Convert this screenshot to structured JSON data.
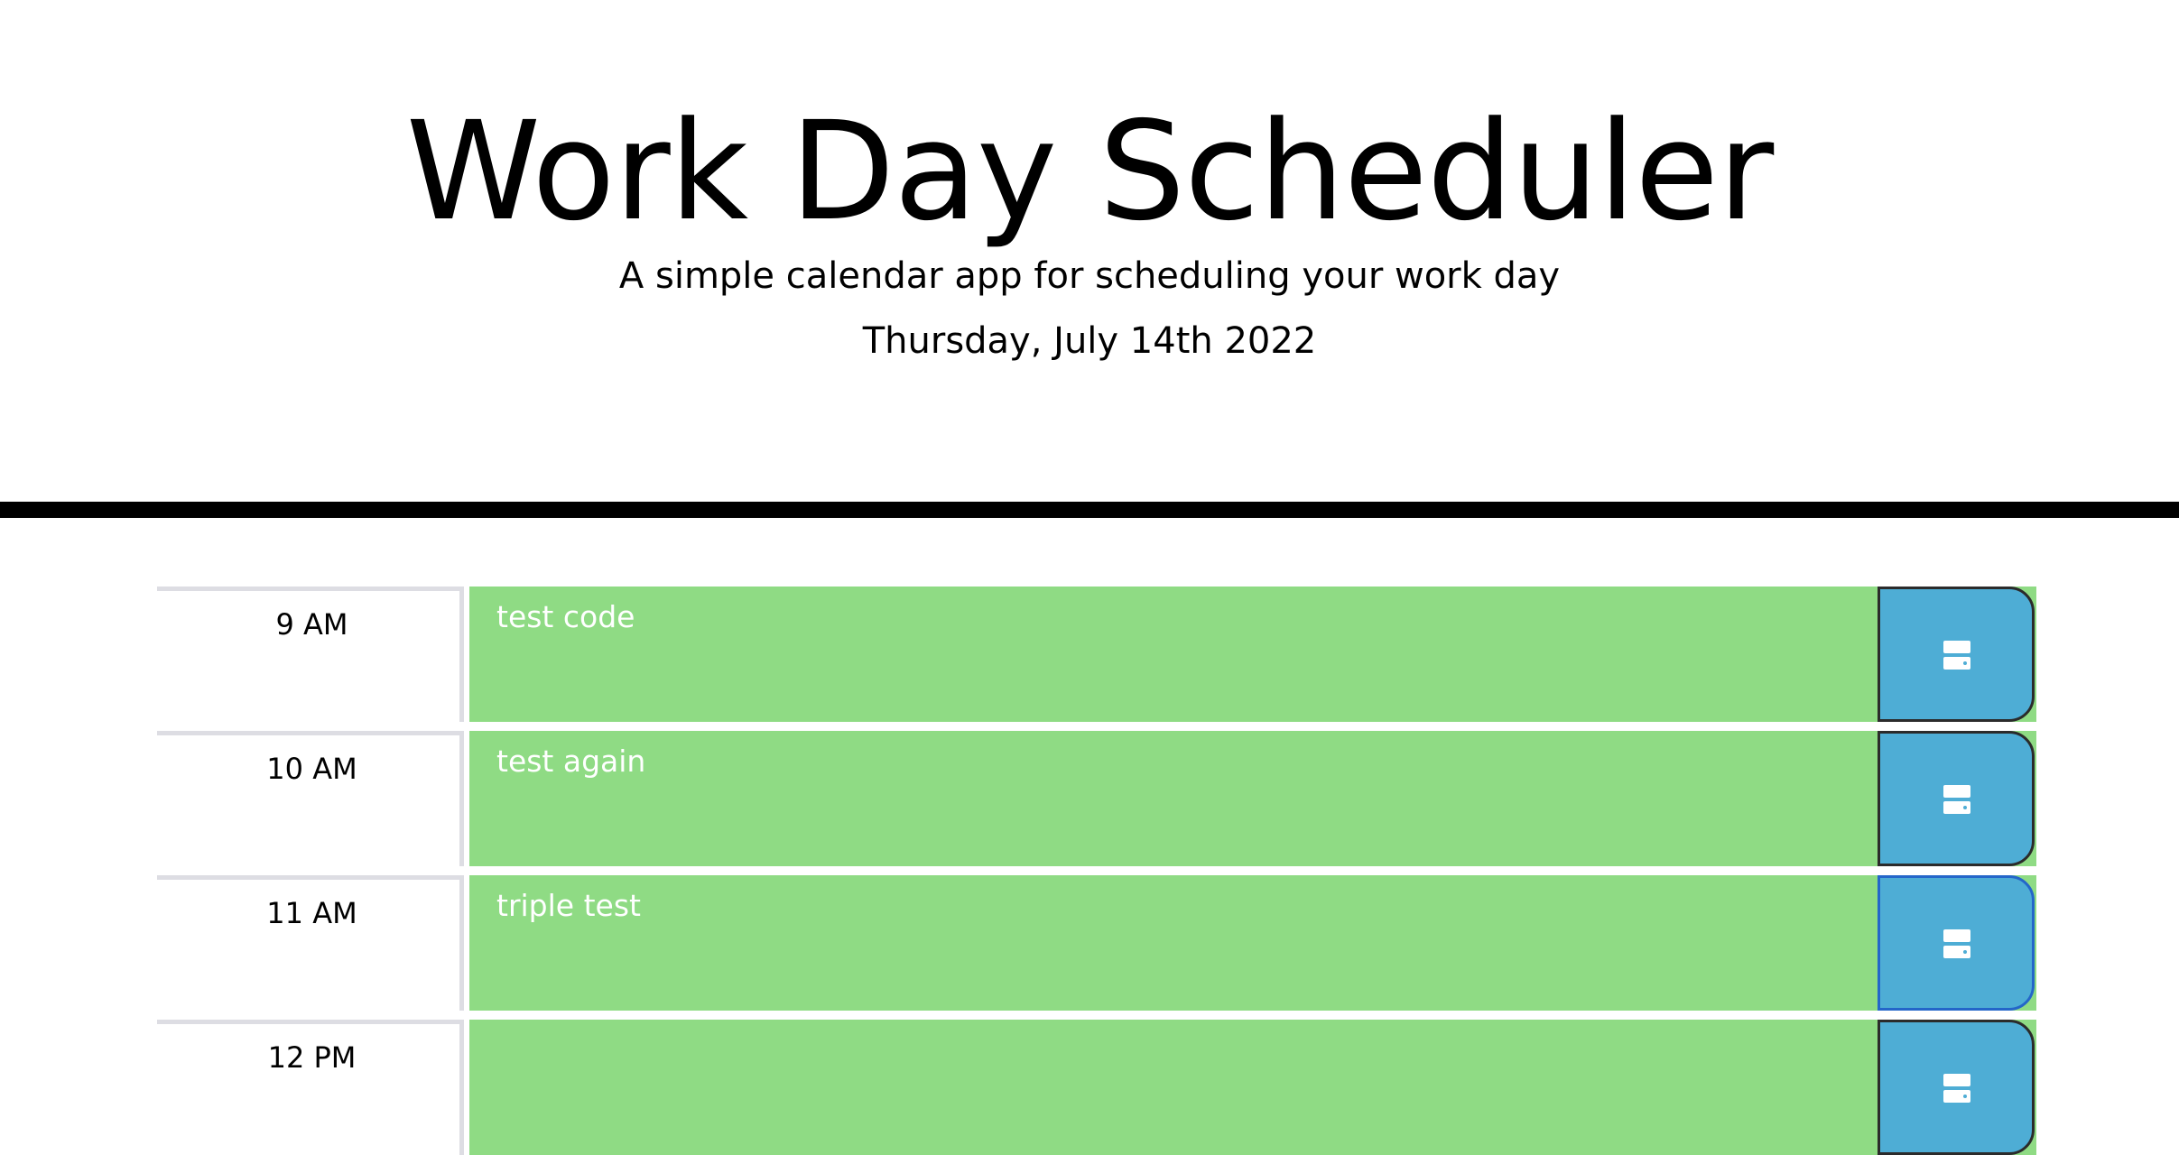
{
  "header": {
    "title": "Work Day Scheduler",
    "subtitle": "A simple calendar app for scheduling your work day",
    "current_day": "Thursday, July 14th 2022"
  },
  "colors": {
    "present_row": "#8fdb84",
    "save_button": "#4eadd5",
    "divider": "#000000"
  },
  "timeblocks": [
    {
      "hour": "9 AM",
      "text": "test code",
      "save_icon": "save-icon"
    },
    {
      "hour": "10 AM",
      "text": "test again",
      "save_icon": "save-icon"
    },
    {
      "hour": "11 AM",
      "text": "triple test",
      "save_icon": "save-icon"
    },
    {
      "hour": "12 PM",
      "text": "",
      "save_icon": "save-icon"
    }
  ]
}
